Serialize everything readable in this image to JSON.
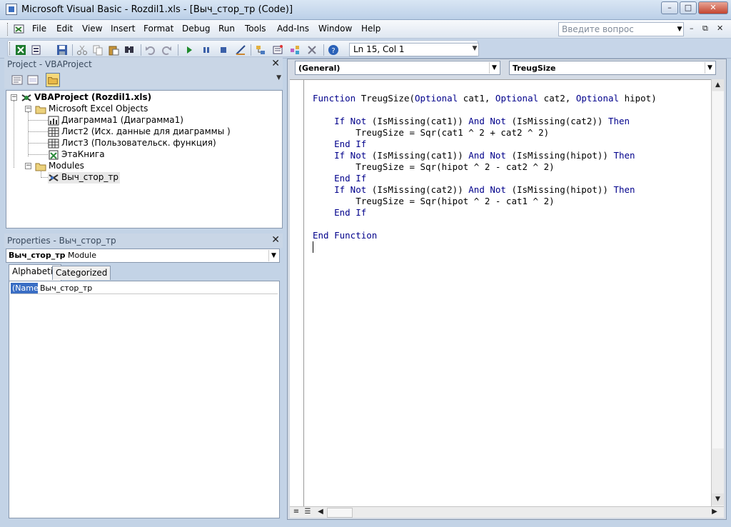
{
  "window": {
    "title": "Microsoft Visual Basic - Rozdil1.xls - [Выч_стор_тр (Code)]",
    "minimize": "–",
    "maximize": "□",
    "close": "✕"
  },
  "menubar": {
    "items": [
      "File",
      "Edit",
      "View",
      "Insert",
      "Format",
      "Debug",
      "Run",
      "Tools",
      "Add-Ins",
      "Window",
      "Help"
    ],
    "ask_placeholder": "Введите вопрос",
    "mdi_minimize": "–",
    "mdi_restore": "⧉",
    "mdi_close": "✕"
  },
  "toolbar": {
    "status": "Ln 15, Col 1",
    "icons": [
      "view-excel-icon",
      "insert-module-icon",
      "save-icon",
      "cut-icon",
      "copy-icon",
      "paste-icon",
      "find-icon",
      "undo-icon",
      "redo-icon",
      "run-icon",
      "break-icon",
      "reset-icon",
      "design-mode-icon",
      "project-explorer-icon",
      "properties-icon",
      "object-browser-icon",
      "toolbox-icon",
      "help-icon"
    ]
  },
  "project_panel": {
    "title": "Project - VBAProject",
    "tree": {
      "root": "VBAProject (Rozdil1.xls)",
      "excel_objects_folder": "Microsoft Excel Objects",
      "excel_objects": [
        "Диаграмма1 (Диаграмма1)",
        "Лист2 (Исх. данные для диаграммы )",
        "Лист3 (Пользовательск. функция)",
        "ЭтаКнига"
      ],
      "modules_folder": "Modules",
      "modules": [
        "Выч_стор_тр"
      ]
    }
  },
  "properties_panel": {
    "title": "Properties - Выч_стор_тр",
    "object_name": "Выч_стор_тр",
    "object_type": "Module",
    "tabs": [
      "Alphabetic",
      "Categorized"
    ],
    "rows": [
      {
        "name": "(Name)",
        "value": "Выч_стор_тр"
      }
    ]
  },
  "code_window": {
    "object_combo": "(General)",
    "procedure_combo": "TreugSize",
    "lines": [
      [
        {
          "t": "Function",
          "k": true
        },
        {
          "t": " TreugSize("
        },
        {
          "t": "Optional",
          "k": true
        },
        {
          "t": " cat1, "
        },
        {
          "t": "Optional",
          "k": true
        },
        {
          "t": " cat2, "
        },
        {
          "t": "Optional",
          "k": true
        },
        {
          "t": " hipot)"
        }
      ],
      [],
      [
        {
          "t": "    "
        },
        {
          "t": "If Not",
          "k": true
        },
        {
          "t": " (IsMissing(cat1)) "
        },
        {
          "t": "And Not",
          "k": true
        },
        {
          "t": " (IsMissing(cat2)) "
        },
        {
          "t": "Then",
          "k": true
        }
      ],
      [
        {
          "t": "        TreugSize = Sqr(cat1 ^ 2 + cat2 ^ 2)"
        }
      ],
      [
        {
          "t": "    "
        },
        {
          "t": "End If",
          "k": true
        }
      ],
      [
        {
          "t": "    "
        },
        {
          "t": "If Not",
          "k": true
        },
        {
          "t": " (IsMissing(cat1)) "
        },
        {
          "t": "And Not",
          "k": true
        },
        {
          "t": " (IsMissing(hipot)) "
        },
        {
          "t": "Then",
          "k": true
        }
      ],
      [
        {
          "t": "        TreugSize = Sqr(hipot ^ 2 - cat2 ^ 2)"
        }
      ],
      [
        {
          "t": "    "
        },
        {
          "t": "End If",
          "k": true
        }
      ],
      [
        {
          "t": "    "
        },
        {
          "t": "If Not",
          "k": true
        },
        {
          "t": " (IsMissing(cat2)) "
        },
        {
          "t": "And Not",
          "k": true
        },
        {
          "t": " (IsMissing(hipot)) "
        },
        {
          "t": "Then",
          "k": true
        }
      ],
      [
        {
          "t": "        TreugSize = Sqr(hipot ^ 2 - cat1 ^ 2)"
        }
      ],
      [
        {
          "t": "    "
        },
        {
          "t": "End If",
          "k": true
        }
      ],
      [],
      [
        {
          "t": "End Function",
          "k": true
        }
      ]
    ]
  },
  "colors": {
    "keyword": "#00008b",
    "code_text": "#000000",
    "selection": "#3a6ec4"
  }
}
